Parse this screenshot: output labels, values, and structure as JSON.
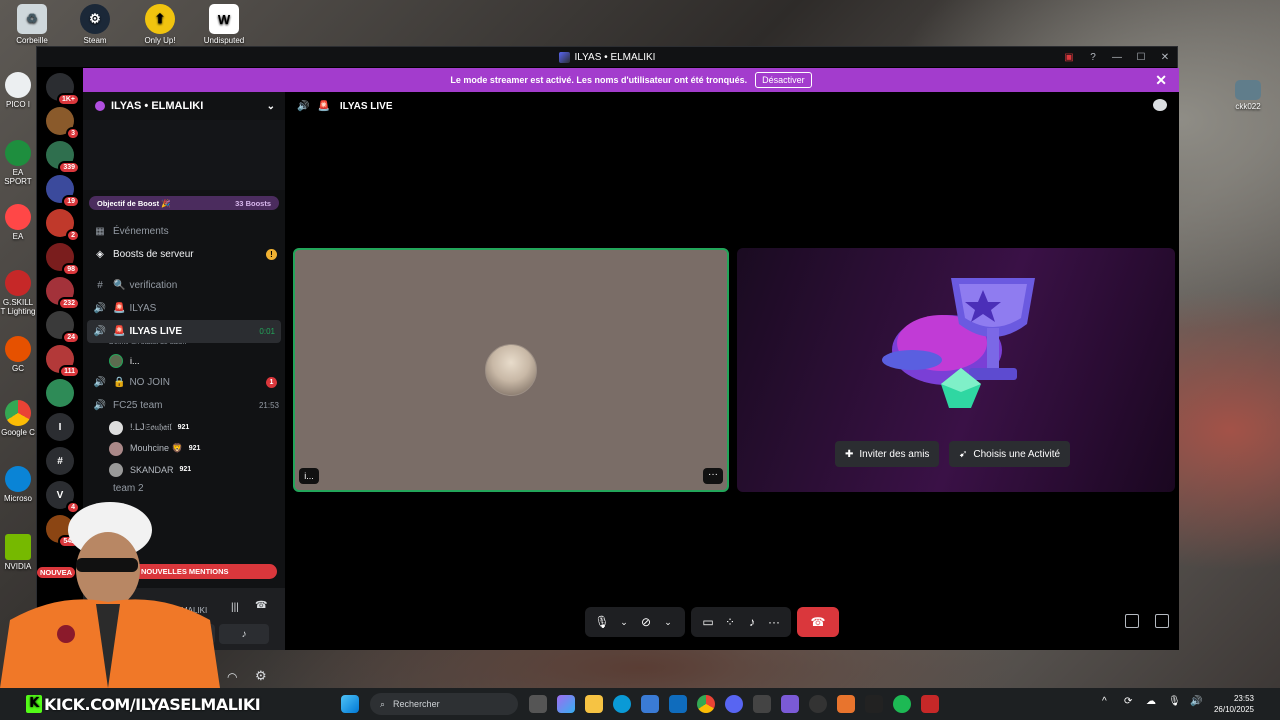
{
  "desktop": {
    "top_icons": [
      {
        "label": "Corbeille"
      },
      {
        "label": "Steam"
      },
      {
        "label": "Only Up!"
      },
      {
        "label": "Undisputed"
      }
    ],
    "right_icon": {
      "label": "ckk022"
    },
    "left_icons": [
      {
        "label": "PICO I"
      },
      {
        "label": "EA SPORT"
      },
      {
        "label": "EA"
      },
      {
        "label": "G.SKILL T Lighting"
      },
      {
        "label": "GC"
      },
      {
        "label": "Google C"
      },
      {
        "label": "Microso"
      },
      {
        "label": "NVIDIA"
      }
    ]
  },
  "window": {
    "title": "ILYAS • ELMALIKI",
    "controls": [
      "—",
      "☐",
      "✕"
    ]
  },
  "banner": {
    "text": "Le mode streamer est activé. Les noms d'utilisateur ont été tronqués.",
    "button": "Désactiver",
    "close": "✕"
  },
  "rail": {
    "servers": [
      {
        "badge": "1K+",
        "color": "#2b2d31"
      },
      {
        "badge": "3",
        "color": "#8a5a2b"
      },
      {
        "badge": "339",
        "color": "#2f6f4e"
      },
      {
        "badge": "19",
        "color": "#3b4a9c"
      },
      {
        "badge": "2",
        "color": "#c0392b"
      },
      {
        "badge": "98",
        "color": "#7a1d1d"
      },
      {
        "badge": "232",
        "color": "#a3323a"
      },
      {
        "badge": "24",
        "color": "#3a3a3a"
      },
      {
        "badge": "111",
        "color": "#b33939"
      },
      {
        "badge": "",
        "color": "#2e8b57"
      },
      {
        "badge": "",
        "color": "#2b2d31",
        "letter": "I"
      },
      {
        "badge": "",
        "color": "#2b2d31",
        "letter": "#"
      },
      {
        "badge": "4",
        "color": "#2b2d31",
        "letter": "V"
      },
      {
        "badge": "542",
        "color": "#8b4513"
      }
    ]
  },
  "server": {
    "name": "ILYAS • ELMALIKI",
    "boost": {
      "label": "Objectif de Boost 🎉",
      "count": "33 Boosts"
    },
    "events": "Événements",
    "boosts": "Boosts de serveur",
    "boosts_alert": "!",
    "channels": [
      {
        "name": "verification",
        "icon": "#"
      },
      {
        "name": "ILYAS",
        "icon": "🔊"
      },
      {
        "name": "ILYAS LIVE",
        "icon": "🔊",
        "time": "0:01",
        "status": "Définir un statut de salon"
      },
      {
        "name": "NO JOIN",
        "icon": "🔊",
        "badge": "1"
      },
      {
        "name": "FC25 team",
        "icon": "🔊",
        "time": "21:53"
      }
    ],
    "live_member": "i...",
    "fc25_members": [
      {
        "name": "!.LJ𝔖𝔬𝔲𝔥𝔞𝔦𝔩",
        "tag": "921"
      },
      {
        "name": "Mouhcine 🦁",
        "tag": "921"
      },
      {
        "name": "SKANDAR",
        "tag": "921"
      }
    ],
    "next_channel": "team 2",
    "mentions": "NOUVELLES MENTIONS",
    "mentions_prefix": "NOUVEA",
    "user_panel_name": "MALIKI"
  },
  "call": {
    "channel": "ILYAS LIVE",
    "tile_name": "i...",
    "tile_more": "···",
    "invite": "Inviter des amis",
    "activity": "Choisis une Activité"
  },
  "taskbar": {
    "search_placeholder": "Rechercher",
    "time": "23:53",
    "date": "26/10/2025"
  },
  "overlay": {
    "kick_url": "KICK.COM/ILYASELMALIKI",
    "kick_letter": "K"
  }
}
